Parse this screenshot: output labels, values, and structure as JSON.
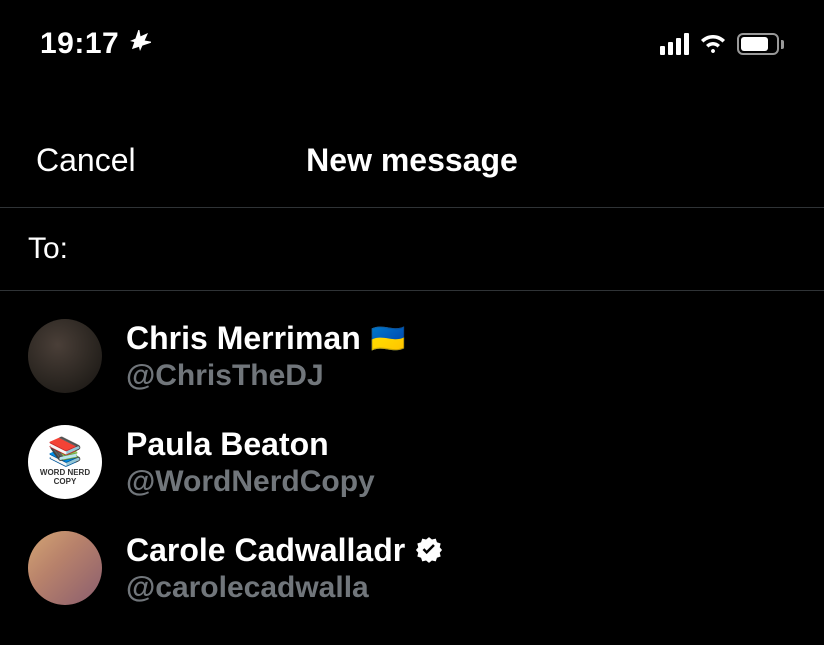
{
  "status_bar": {
    "time": "19:17"
  },
  "modal": {
    "cancel_label": "Cancel",
    "title": "New message",
    "to_label": "To:",
    "to_value": ""
  },
  "suggestions": [
    {
      "name": "Chris Merriman",
      "flag": "🇺🇦",
      "handle": "@ChrisTheDJ",
      "verified": false
    },
    {
      "name": "Paula Beaton",
      "handle": "@WordNerdCopy",
      "verified": false,
      "avatar_text": "WORD NERD COPY"
    },
    {
      "name": "Carole Cadwalladr",
      "handle": "@carolecadwalla",
      "verified": true
    }
  ]
}
